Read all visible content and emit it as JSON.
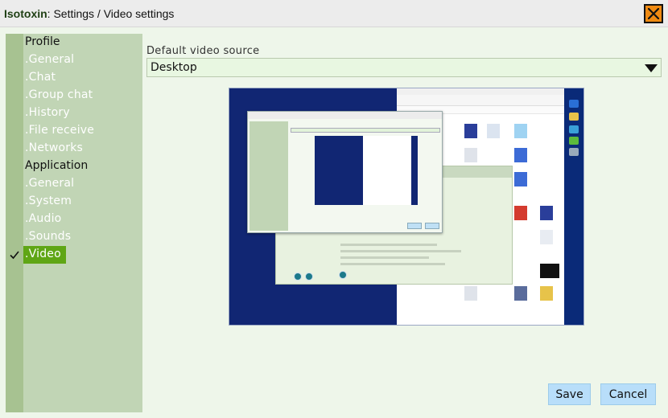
{
  "window": {
    "app_name": "Isotoxin",
    "title_rest": ": Settings / Video settings"
  },
  "sidebar": {
    "groups": [
      {
        "label": "Profile",
        "items": [
          ".General",
          ".Chat",
          ".Group chat",
          ".History",
          ".File receive",
          ".Networks"
        ]
      },
      {
        "label": "Application",
        "items": [
          ".General",
          ".System",
          ".Audio",
          ".Sounds",
          ".Video"
        ]
      }
    ],
    "active_item": ".Video"
  },
  "video": {
    "source_label": "Default video source",
    "source_value": "Desktop"
  },
  "buttons": {
    "save": "Save",
    "cancel": "Cancel"
  },
  "colors": {
    "accent_green": "#5fa615",
    "sidebar_bg": "#c1d5b5",
    "button_blue": "#b8defa",
    "close_orange": "#ef8a12"
  },
  "icons": {
    "close": "close-icon",
    "dropdown": "chevron-down-icon",
    "check": "check-icon"
  }
}
